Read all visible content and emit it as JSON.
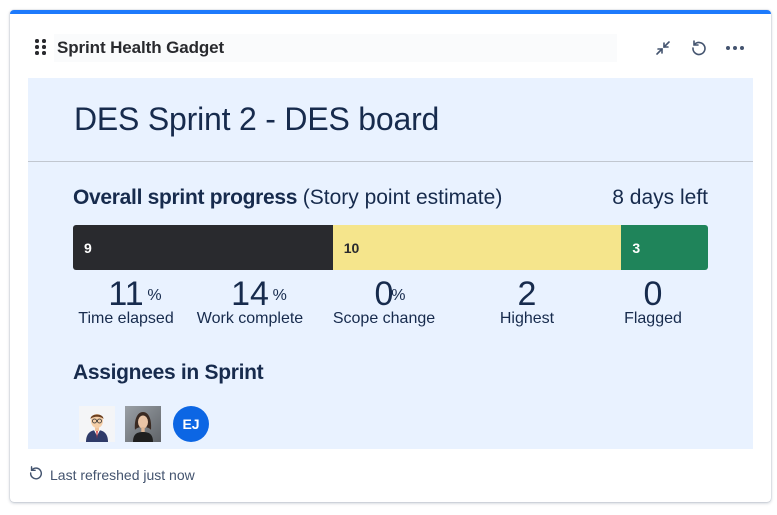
{
  "gadget": {
    "title": "Sprint Health Gadget",
    "controls": {
      "minimize_icon": "collapse-arrows-icon",
      "refresh_icon": "refresh-icon",
      "more_icon": "more-horizontal-icon"
    }
  },
  "sprint": {
    "name": "DES Sprint 2 - DES board"
  },
  "progress": {
    "label": "Overall sprint progress",
    "sublabel": "(Story point estimate)",
    "days_left": "8 days left",
    "segments": [
      {
        "status": "to-do",
        "value": "9",
        "points": 9,
        "color": "#292a2e"
      },
      {
        "status": "in-progress",
        "value": "10",
        "points": 10,
        "color": "#f5e58c"
      },
      {
        "status": "done",
        "value": "3",
        "points": 3,
        "color": "#1f845a"
      }
    ]
  },
  "metrics": [
    {
      "value": "11",
      "unit": "%",
      "label": "Time elapsed"
    },
    {
      "value": "14",
      "unit": "%",
      "label": "Work complete"
    },
    {
      "value": "0",
      "unit": "%",
      "label": "Scope change"
    },
    {
      "value": "2",
      "unit": "",
      "label": "Highest"
    },
    {
      "value": "0",
      "unit": "",
      "label": "Flagged"
    }
  ],
  "assignees": {
    "title": "Assignees in Sprint",
    "people": [
      {
        "type": "cartoon-avatar-man",
        "initials": ""
      },
      {
        "type": "photo-avatar-woman",
        "initials": ""
      },
      {
        "type": "initials-avatar",
        "initials": "EJ"
      }
    ]
  },
  "footer": {
    "icon": "refresh-icon",
    "text": "Last refreshed just now"
  }
}
